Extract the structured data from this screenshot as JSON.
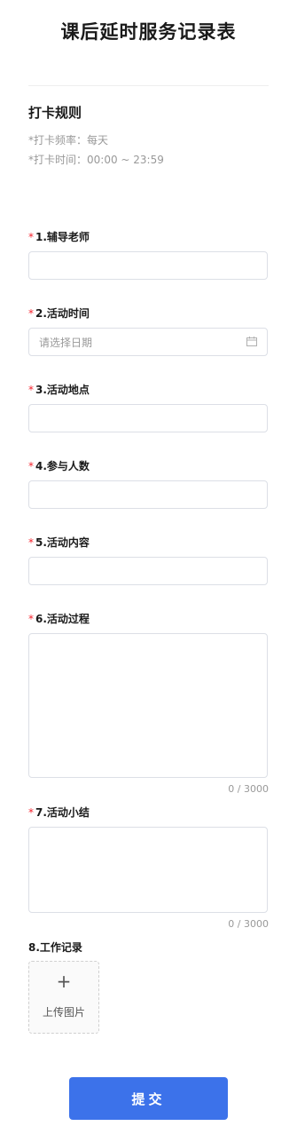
{
  "page": {
    "title": "课后延时服务记录表"
  },
  "rules": {
    "title": "打卡规则",
    "frequency": "*打卡频率：每天",
    "time": "*打卡时间：00:00 ~ 23:59"
  },
  "fields": {
    "required_mark": "*",
    "teacher": {
      "label": "1.辅导老师",
      "value": ""
    },
    "date": {
      "label": "2.活动时间",
      "placeholder": "请选择日期"
    },
    "location": {
      "label": "3.活动地点",
      "value": ""
    },
    "participants": {
      "label": "4.参与人数",
      "value": ""
    },
    "content": {
      "label": "5.活动内容",
      "value": ""
    },
    "process": {
      "label": "6.活动过程",
      "value": "",
      "counter": "0 / 3000"
    },
    "summary": {
      "label": "7.活动小结",
      "value": "",
      "counter": "0 / 3000"
    },
    "work_record": {
      "label": "8.工作记录",
      "plus": "+",
      "upload_text": "上传图片"
    }
  },
  "icons": {
    "calendar": "calendar-icon",
    "plus": "plus-icon"
  },
  "colors": {
    "accent": "#3c72ea",
    "required": "#f5222d",
    "hint": "#999999"
  },
  "submit": {
    "label": "提交"
  }
}
